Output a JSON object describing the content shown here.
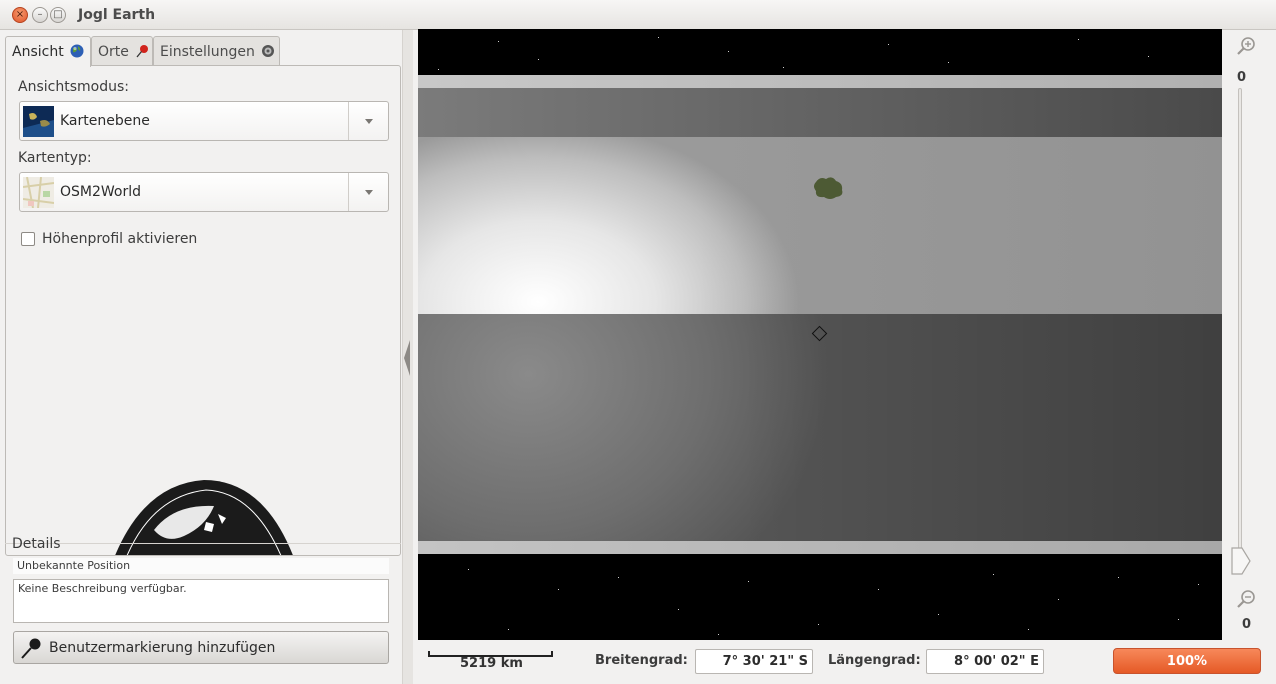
{
  "window": {
    "title": "Jogl Earth",
    "close_glyph": "×",
    "min_glyph": "–",
    "max_glyph": "□"
  },
  "tabs": [
    {
      "label": "Ansicht",
      "icon": "globe-icon"
    },
    {
      "label": "Orte",
      "icon": "pin-icon"
    },
    {
      "label": "Einstellungen",
      "icon": "gear-icon"
    }
  ],
  "view": {
    "mode_label": "Ansichtsmodus:",
    "mode_value": "Kartenebene",
    "maptype_label": "Kartentyp:",
    "maptype_value": "OSM2World",
    "elevation_label": "Höhenprofil aktivieren",
    "elevation_checked": false
  },
  "details": {
    "header": "Details",
    "position": "Unbekannte Position",
    "description": "Keine Beschreibung verfügbar.",
    "add_button": "Benutzermarkierung hinzufügen"
  },
  "zoom": {
    "top_value": "0",
    "bottom_value": "0",
    "level": 0.0
  },
  "status": {
    "scale": "5219 km",
    "lat_label": "Breitengrad:",
    "lat_value": "7° 30' 21\" S",
    "lon_label": "Längengrad:",
    "lon_value": "8° 00' 02\" E",
    "progress": "100%"
  },
  "colors": {
    "accent": "#e9632f",
    "close_button": "#e0552a"
  }
}
